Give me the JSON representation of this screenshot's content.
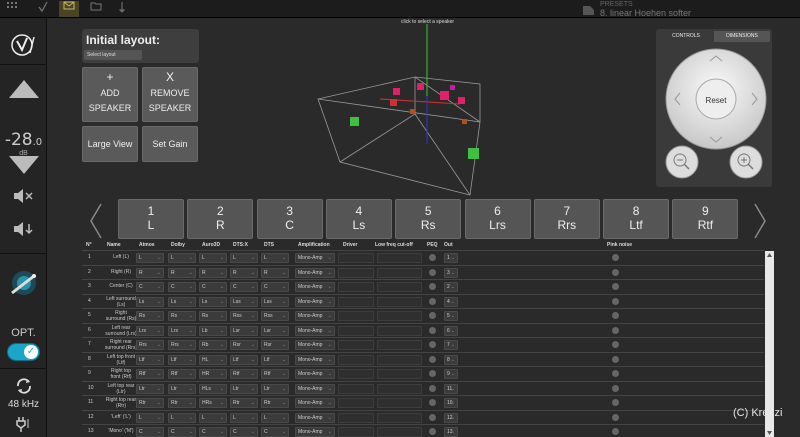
{
  "topbar": {
    "presets_label": "PRESETS",
    "preset_name": "8. linear Hoehen softer",
    "icons": [
      "menu-icon",
      "check-icon",
      "message-icon",
      "folder-icon",
      "pen-icon"
    ]
  },
  "sidebar": {
    "volume": "-28",
    "volume_decimal": ".0",
    "volume_unit": "dB",
    "opt_label": "OPT.",
    "sample_rate": "48 kHz",
    "accent": "#1aa6c8"
  },
  "layout": {
    "initial_layout_title": "Initial layout:",
    "select_placeholder": "Select layout",
    "add_symbol": "+",
    "add_label_1": "ADD",
    "add_label_2": "SPEAKER",
    "remove_symbol": "X",
    "remove_label_1": "REMOVE",
    "remove_label_2": "SPEAKER",
    "large_view": "Large View",
    "set_gain": "Set Gain"
  },
  "viewport": {
    "hint": "click to select a speaker"
  },
  "controls": {
    "tab_controls": "CONTROLS",
    "tab_dimensions": "DIMENSIONS",
    "reset": "Reset"
  },
  "speakers": [
    {
      "num": "1",
      "code": "L"
    },
    {
      "num": "2",
      "code": "R"
    },
    {
      "num": "3",
      "code": "C"
    },
    {
      "num": "4",
      "code": "Ls"
    },
    {
      "num": "5",
      "code": "Rs"
    },
    {
      "num": "6",
      "code": "Lrs"
    },
    {
      "num": "7",
      "code": "Rrs"
    },
    {
      "num": "8",
      "code": "Ltf"
    },
    {
      "num": "9",
      "code": "Rtf"
    }
  ],
  "table": {
    "headers": [
      "N°",
      "Name",
      "Atmos",
      "Dolby",
      "Auro3D",
      "DTS:X",
      "DTS",
      "Amplification",
      "Driver",
      "Low freq cut-off",
      "PEQ",
      "Out",
      "Pink noise"
    ],
    "rows": [
      {
        "n": "1",
        "name": "Left (L)",
        "name2": "",
        "atmos": "L",
        "dolby": "L",
        "auro": "L",
        "dtsx": "L",
        "dts": "L",
        "amp": "Mono-Amp",
        "out": "1"
      },
      {
        "n": "2",
        "name": "Right (R)",
        "name2": "",
        "atmos": "R",
        "dolby": "R",
        "auro": "R",
        "dtsx": "R",
        "dts": "R",
        "amp": "Mono-Amp",
        "out": "3"
      },
      {
        "n": "3",
        "name": "Center (C)",
        "name2": "",
        "atmos": "C",
        "dolby": "C",
        "auro": "C",
        "dtsx": "C",
        "dts": "C",
        "amp": "Mono-Amp",
        "out": "2"
      },
      {
        "n": "4",
        "name": "Left surround",
        "name2": "(Ls)",
        "atmos": "Ls",
        "dolby": "Ls",
        "auro": "Ls",
        "dtsx": "Lss",
        "dts": "Lss",
        "amp": "Mono-Amp",
        "out": "4"
      },
      {
        "n": "5",
        "name": "Right",
        "name2": "surround (Rs)",
        "atmos": "Rs",
        "dolby": "Rs",
        "auro": "Rs",
        "dtsx": "Rss",
        "dts": "Rss",
        "amp": "Mono-Amp",
        "out": "5"
      },
      {
        "n": "6",
        "name": "Left rear",
        "name2": "surround (Lrs)",
        "atmos": "Lrs",
        "dolby": "Lrs",
        "auro": "Lb",
        "dtsx": "Lsr",
        "dts": "Lsr",
        "amp": "Mono-Amp",
        "out": "6"
      },
      {
        "n": "7",
        "name": "Right rear",
        "name2": "surround (Rrs)",
        "atmos": "Rrs",
        "dolby": "Rrs",
        "auro": "Rb",
        "dtsx": "Rsr",
        "dts": "Rsr",
        "amp": "Mono-Amp",
        "out": "7"
      },
      {
        "n": "8",
        "name": "Left top front",
        "name2": "(Ltf)",
        "atmos": "Ltf",
        "dolby": "Ltf",
        "auro": "HL",
        "dtsx": "Ltf",
        "dts": "Ltf",
        "amp": "Mono-Amp",
        "out": "8"
      },
      {
        "n": "9",
        "name": "Right top",
        "name2": "front (Rtf)",
        "atmos": "Rtf",
        "dolby": "Rtf",
        "auro": "HR",
        "dtsx": "Rtf",
        "dts": "Rtf",
        "amp": "Mono-Amp",
        "out": "9"
      },
      {
        "n": "10",
        "name": "Left top rear",
        "name2": "(Ltr)",
        "atmos": "Ltr",
        "dolby": "Ltr",
        "auro": "HLs",
        "dtsx": "Ltr",
        "dts": "Ltr",
        "amp": "Mono-Amp",
        "out": "11"
      },
      {
        "n": "11",
        "name": "Right top rear",
        "name2": "(Rtr)",
        "atmos": "Rtr",
        "dolby": "Rtr",
        "auro": "HRs",
        "dtsx": "Rtr",
        "dts": "Rtr",
        "amp": "Mono-Amp",
        "out": "10"
      },
      {
        "n": "12",
        "name": "'Left' ('L')",
        "name2": "",
        "atmos": "L",
        "dolby": "L",
        "auro": "L",
        "dtsx": "L",
        "dts": "L",
        "amp": "Mono-Amp",
        "out": "12"
      },
      {
        "n": "13",
        "name": "'Mono' ('M')",
        "name2": "",
        "atmos": "C",
        "dolby": "C",
        "auro": "C",
        "dtsx": "C",
        "dts": "C",
        "amp": "Mono-Amp",
        "out": "13"
      }
    ]
  },
  "watermark": "(C) Kreuzi"
}
